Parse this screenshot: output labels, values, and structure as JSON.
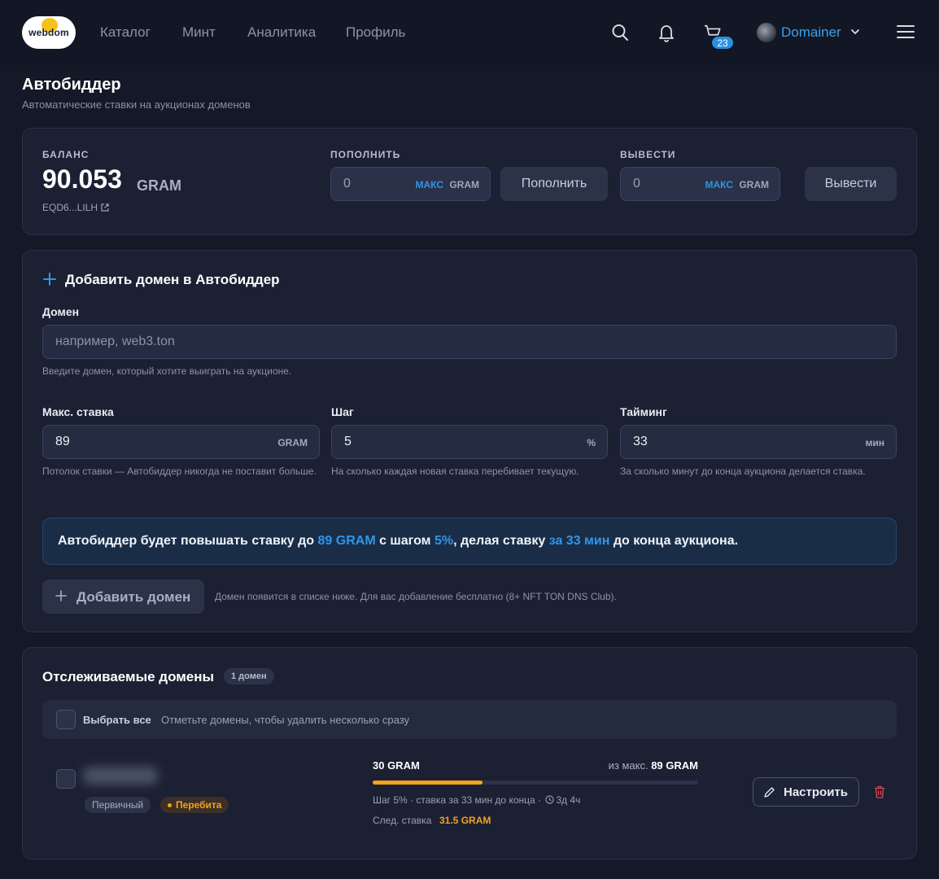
{
  "header": {
    "logo_text": "webdom",
    "nav": [
      "Каталог",
      "Минт",
      "Аналитика",
      "Профиль"
    ],
    "cart_count": "23",
    "username": "Domainer"
  },
  "page": {
    "title": "Автобиддер",
    "subtitle": "Автоматические ставки на аукционах доменов"
  },
  "balance": {
    "label": "БАЛАНС",
    "amount": "90.053",
    "unit": "GRAM",
    "wallet": "EQD6...LILH"
  },
  "deposit": {
    "label": "ПОПОЛНИТЬ",
    "value": "0",
    "max": "МАКС",
    "unit": "GRAM",
    "button": "Пополнить"
  },
  "withdraw": {
    "label": "ВЫВЕСТИ",
    "value": "0",
    "max": "МАКС",
    "unit": "GRAM",
    "button": "Вывести"
  },
  "add_form": {
    "title": "Добавить домен в Автобиддер",
    "domain_label": "Домен",
    "domain_placeholder": "например, web3.ton",
    "domain_hint": "Введите домен, который хотите выиграть на аукционе.",
    "max_bid_label": "Макс. ставка",
    "max_bid_value": "89",
    "max_bid_unit": "GRAM",
    "max_bid_hint": "Потолок ставки — Автобиддер никогда не поставит больше.",
    "step_label": "Шаг",
    "step_value": "5",
    "step_unit": "%",
    "step_hint": "На сколько каждая новая ставка перебивает текущую.",
    "timing_label": "Тайминг",
    "timing_value": "33",
    "timing_unit": "мин",
    "timing_hint": "За сколько минут до конца аукциона делается ставка.",
    "summary": {
      "p1": "Автобиддер будет повышать ставку до ",
      "h1": "89 GRAM",
      "p2": " с шагом ",
      "h2": "5%",
      "p3": ", делая ставку ",
      "h3": "за 33 мин",
      "p4": " до конца аукциона."
    },
    "add_button": "Добавить домен",
    "add_note": "Домен появится в списке ниже. Для вас добавление бесплатно (8+ NFT TON DNS Club)."
  },
  "tracked": {
    "title": "Отслеживаемые домены",
    "count_badge": "1 домен",
    "select_all": "Выбрать все",
    "select_hint": "Отметьте домены, чтобы удалить несколько сразу",
    "item": {
      "tag_primary": "Первичный",
      "tag_status": "Перебита",
      "current_bid": "30 GRAM",
      "max_prefix": "из макс. ",
      "max_value": "89 GRAM",
      "progress": 0.337,
      "details": "Шаг 5% · ставка за 33 мин до конца ·",
      "time_left": "3д 4ч",
      "next_label": "След. ставка",
      "next_value": "31.5 GRAM",
      "configure_button": "Настроить"
    }
  },
  "colors": {
    "accent": "#2f97ea",
    "warning": "#f5a21c",
    "danger": "#e0464e",
    "background": "#141827",
    "card": "#1b2033"
  }
}
